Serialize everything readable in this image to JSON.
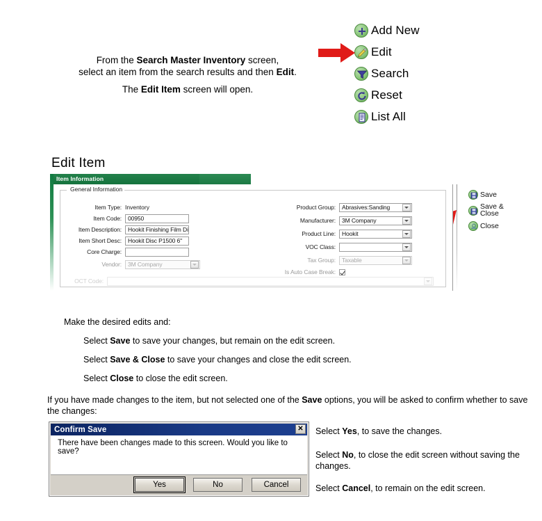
{
  "intro": {
    "line1_a": "From the ",
    "line1_b": "Search Master Inventory",
    "line1_c": " screen,",
    "line2_a": "select an item from the search results and then ",
    "line2_b": "Edit",
    "line2_c": ".",
    "line3_a": "The ",
    "line3_b": "Edit Item",
    "line3_c": " screen will open."
  },
  "action_menu": {
    "items": [
      {
        "label": "Add New",
        "icon": "plus-icon"
      },
      {
        "label": "Edit",
        "icon": "pencil-icon"
      },
      {
        "label": "Search",
        "icon": "funnel-icon"
      },
      {
        "label": "Reset",
        "icon": "refresh-icon"
      },
      {
        "label": "List All",
        "icon": "list-icon"
      }
    ]
  },
  "form_section": {
    "heading": "Edit Item",
    "tab_label": "Item Information",
    "fieldset_legend": "General Information",
    "left_fields": [
      {
        "label": "Item Type:",
        "value": "Inventory",
        "type": "text",
        "dim": false
      },
      {
        "label": "Item Code:",
        "value": "00950",
        "type": "input",
        "dim": false
      },
      {
        "label": "Item Description:",
        "value": "Hookit Finishing Film Disc,",
        "type": "input",
        "dim": false
      },
      {
        "label": "Item Short Desc:",
        "value": "Hookit Disc P1500 6\"",
        "type": "input",
        "dim": false
      },
      {
        "label": "Core Charge:",
        "value": "",
        "type": "input",
        "dim": false
      },
      {
        "label": "Vendor:",
        "value": "3M Company",
        "type": "combo",
        "dim": true
      }
    ],
    "right_fields": [
      {
        "label": "Product Group:",
        "value": "Abrasives:Sanding",
        "type": "combo",
        "dim": false
      },
      {
        "label": "Manufacturer:",
        "value": "3M Company",
        "type": "combo",
        "dim": false
      },
      {
        "label": "Product Line:",
        "value": "Hookit",
        "type": "combo",
        "dim": false
      },
      {
        "label": "VOC Class:",
        "value": "",
        "type": "combo",
        "dim": false
      },
      {
        "label": "Tax Group:",
        "value": "Taxable",
        "type": "combo",
        "dim": true
      },
      {
        "label": "Is Auto Case Break:",
        "value": "",
        "type": "checkbox",
        "dim": true
      }
    ],
    "faded_field": {
      "label": "OCT Code:",
      "value": ""
    }
  },
  "save_menu": {
    "items": [
      {
        "label": "Save",
        "icon": "floppy-icon",
        "line2": ""
      },
      {
        "label": "Save &",
        "icon": "floppy-icon",
        "line2": "Close"
      },
      {
        "label": "Close",
        "icon": "close-door-icon",
        "line2": ""
      }
    ]
  },
  "instructions": {
    "lead": "Make the desired edits and:",
    "items": [
      {
        "pre": "Select ",
        "bold": "Save",
        "post": " to save your changes, but remain on the edit screen."
      },
      {
        "pre": "Select ",
        "bold": "Save & Close",
        "post": " to save your changes and close the edit screen."
      },
      {
        "pre": "Select ",
        "bold": "Close",
        "post": " to close the edit screen."
      }
    ]
  },
  "confirm_para": {
    "pre": "If you have made changes to the item, but not selected one of the ",
    "bold": "Save",
    "post": " options, you will be asked to confirm whether to save the changes:"
  },
  "dialog": {
    "title": "Confirm Save",
    "close_glyph": "✕",
    "message": "There have been changes made to this screen. Would you like to save?",
    "buttons": [
      {
        "label": "Yes",
        "default": true
      },
      {
        "label": "No",
        "default": false
      },
      {
        "label": "Cancel",
        "default": false
      }
    ]
  },
  "dialog_notes": [
    {
      "pre": "Select ",
      "bold": "Yes",
      "post": ", to save the changes."
    },
    {
      "pre": "Select ",
      "bold": "No",
      "post": ", to close the edit screen without saving the changes."
    },
    {
      "pre": "Select ",
      "bold": "Cancel",
      "post": ", to remain on the edit screen."
    }
  ],
  "colors": {
    "arrow_red": "#e01b18",
    "tab_green": "#15733d",
    "title_navy": "#0b2461",
    "icon_green": "#8cc77d",
    "icon_blue": "#4a4a9e"
  }
}
